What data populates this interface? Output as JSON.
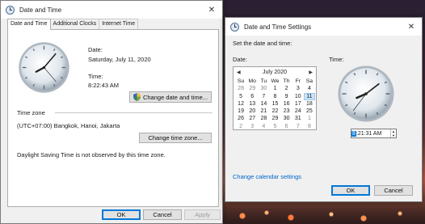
{
  "w1": {
    "title": "Date and Time",
    "close": "✕",
    "tabs": [
      "Date and Time",
      "Additional Clocks",
      "Internet Time"
    ],
    "date_label": "Date:",
    "date_value": "Saturday, July 11, 2020",
    "time_label": "Time:",
    "time_value": "8:22:43 AM",
    "change_datetime_button": "Change date and time...",
    "time_zone_label": "Time zone",
    "time_zone_value": "(UTC+07:00) Bangkok, Hanoi, Jakarta",
    "change_timezone_button": "Change time zone...",
    "dst_text": "Daylight Saving Time is not observed by this time zone.",
    "ok": "OK",
    "cancel": "Cancel",
    "apply": "Apply"
  },
  "w2": {
    "title": "Date and Time Settings",
    "close": "✕",
    "heading": "Set the date and time:",
    "date_label": "Date:",
    "time_label": "Time:",
    "calendar": {
      "month": "July 2020",
      "prev": "◀",
      "next": "▶",
      "days_of_week": [
        "Su",
        "Mo",
        "Tu",
        "We",
        "Th",
        "Fr",
        "Sa"
      ],
      "weeks": [
        [
          "28",
          "29",
          "30",
          "1",
          "2",
          "3",
          "4"
        ],
        [
          "5",
          "6",
          "7",
          "8",
          "9",
          "10",
          "11"
        ],
        [
          "12",
          "13",
          "14",
          "15",
          "16",
          "17",
          "18"
        ],
        [
          "19",
          "20",
          "21",
          "22",
          "23",
          "24",
          "25"
        ],
        [
          "26",
          "27",
          "28",
          "29",
          "30",
          "31",
          "1"
        ],
        [
          "2",
          "3",
          "4",
          "5",
          "6",
          "7",
          "8"
        ]
      ],
      "selected_day": "11"
    },
    "time_hour": "8",
    "time_rest": ":21:31 AM",
    "spin_up": "▲",
    "spin_down": "▼",
    "change_calendar_link": "Change calendar settings",
    "ok": "OK",
    "cancel": "Cancel"
  },
  "icons": {
    "window_icon": "clock-icon",
    "button_shield": "uac-shield-icon"
  },
  "colors": {
    "accent": "#0078d7",
    "link": "#0066cc",
    "calendar_today": "#cce4f7"
  }
}
